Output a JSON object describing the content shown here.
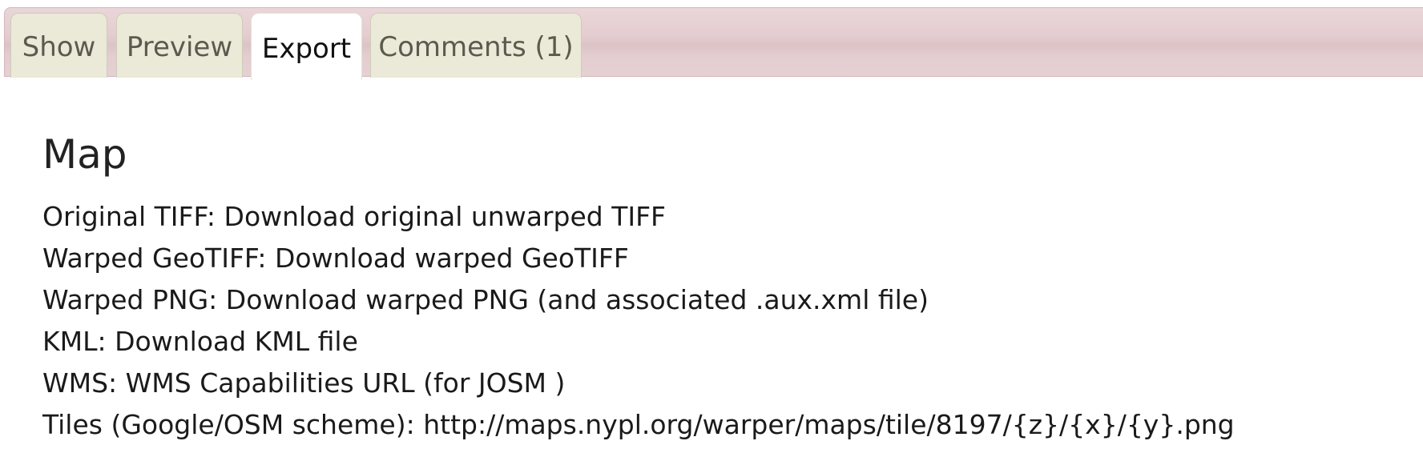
{
  "tabs": [
    {
      "label": "Show",
      "active": false
    },
    {
      "label": "Preview",
      "active": false
    },
    {
      "label": "Export",
      "active": true
    },
    {
      "label": "Comments (1)",
      "active": false
    }
  ],
  "section": {
    "heading": "Map",
    "rows": [
      {
        "label": "Original TIFF:",
        "value": "Download original unwarped TIFF"
      },
      {
        "label": "Warped GeoTIFF:",
        "value": "Download warped GeoTIFF"
      },
      {
        "label": "Warped PNG:",
        "value": "Download warped PNG (and associated .aux.xml file)"
      },
      {
        "label": "KML:",
        "value": "Download KML file"
      },
      {
        "label": "WMS:",
        "value": "WMS Capabilities URL (for JOSM )"
      },
      {
        "label": "Tiles (Google/OSM scheme):",
        "value": "http://maps.nypl.org/warper/maps/tile/8197/{z}/{x}/{y}.png"
      }
    ]
  }
}
